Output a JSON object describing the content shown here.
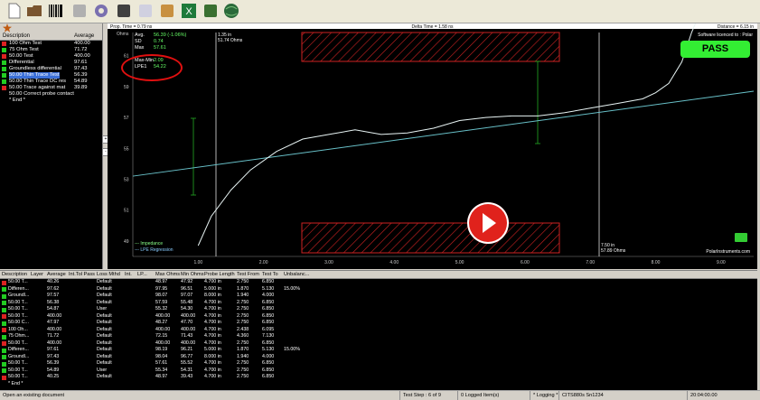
{
  "toolbar": {
    "buttons": [
      "new-document-icon",
      "open-folder-icon",
      "barcode-icon",
      "save-disk-icon",
      "settings-gear-icon",
      "printer-icon",
      "report-icon",
      "probe-icon",
      "excel-export-icon",
      "calibrate-icon",
      "globe-icon"
    ]
  },
  "left_panel": {
    "columns": [
      "Description",
      "Average"
    ],
    "rows": [
      {
        "desc": "100 Ohm Test",
        "avg": "400.00",
        "status": "fail"
      },
      {
        "desc": "75 Ohm Test",
        "avg": "71.72",
        "status": "pass"
      },
      {
        "desc": "50.00 Test",
        "avg": "400.00",
        "status": "fail"
      },
      {
        "desc": "Differential",
        "avg": "97.61",
        "status": "pass"
      },
      {
        "desc": "Groundless differential",
        "avg": "97.43",
        "status": "pass"
      },
      {
        "desc": "50.00 Thin Trace Test",
        "avg": "56.39",
        "status": "pass",
        "selected": true
      },
      {
        "desc": "50.00 Thin Trace DC res",
        "avg": "54.89",
        "status": "pass"
      },
      {
        "desc": "50.00 Trace against mat",
        "avg": "39.89",
        "status": "fail"
      },
      {
        "desc": "50.00 Correct probe contact",
        "avg": "",
        "status": "none"
      },
      {
        "desc": "* End *",
        "avg": "",
        "status": "none"
      }
    ]
  },
  "graph": {
    "prop_time": "Prop. Time = 0.79 ns",
    "delta_time": "Delta Time = 1.58 ns",
    "distance": "Distance = 6.15 in",
    "yunit": "Ohms",
    "stats": [
      {
        "k": "Avg.",
        "v": "56.39 (-1.06%)"
      },
      {
        "k": "SD",
        "v": "0.74"
      },
      {
        "k": "Max",
        "v": "57.61"
      },
      {
        "k": "Max-Min",
        "v": "2.09"
      },
      {
        "k": "LPE1",
        "v": "54.22"
      }
    ],
    "cursor1": {
      "in": "1.35 in",
      "ohms": "51.74 Ohms"
    },
    "cursor2": {
      "in": "7.50 in",
      "ohms": "57.89 Ohms"
    },
    "licence": "Software licenced to : Polar",
    "pass_label": "PASS",
    "legend": [
      "--- Impedance",
      "--- LPE Regression"
    ],
    "brand": "PolarInstruments.com",
    "y_ticks": [
      "61",
      "59",
      "57",
      "55",
      "53",
      "51",
      "49"
    ],
    "x_ticks": [
      "1.00",
      "2.00",
      "3.00",
      "4.00",
      "5.00",
      "6.00",
      "7.00",
      "8.00",
      "9.00"
    ],
    "chart_data": {
      "type": "line",
      "x": [
        1.0,
        1.2,
        1.5,
        1.8,
        2.2,
        2.6,
        3.0,
        3.4,
        3.8,
        4.2,
        4.6,
        5.0,
        5.4,
        5.8,
        6.2,
        6.6,
        7.0,
        7.4,
        7.8,
        8.0,
        8.2,
        8.4,
        8.55,
        8.7
      ],
      "series": [
        {
          "name": "Impedance",
          "values": [
            48.7,
            50.6,
            52.3,
            53.6,
            54.8,
            55.6,
            55.9,
            56.2,
            55.9,
            56.0,
            56.3,
            56.8,
            57.0,
            57.1,
            57.1,
            57.3,
            57.6,
            57.9,
            58.2,
            58.6,
            59.2,
            60.6,
            62.5,
            64.0
          ]
        },
        {
          "name": "LPE Regression",
          "x": [
            0,
            9.5
          ],
          "values": [
            53.2,
            58.7
          ]
        }
      ],
      "xlim": [
        0,
        9.5
      ],
      "ylim": [
        48,
        62.5
      ]
    }
  },
  "table": {
    "columns": [
      "Description",
      "Layer",
      "Average",
      "Int.Tol Pass",
      "Loss Mthd",
      "Int.",
      "LP...",
      "Max Ohms",
      "Min Ohms",
      "Probe Length",
      "Test From",
      "Test To",
      "Unbalanc..."
    ],
    "rows": [
      {
        "st": "fail",
        "c": [
          "50.00 T...",
          "",
          "40.26",
          "",
          "Default",
          "",
          "",
          "48.97",
          "47.92",
          "4.700 in",
          "2.750",
          "6.850",
          ""
        ]
      },
      {
        "st": "pass",
        "c": [
          "Differen...",
          "",
          "97.62",
          "",
          "Default",
          "",
          "",
          "97.95",
          "96.51",
          "5.000 in",
          "1.870",
          "5.130",
          "15.00%"
        ]
      },
      {
        "st": "pass",
        "c": [
          "Groundl...",
          "",
          "97.57",
          "",
          "Default",
          "",
          "",
          "98.07",
          "97.07",
          "8.000 in",
          "1.940",
          "4.000",
          ""
        ]
      },
      {
        "st": "pass",
        "c": [
          "50.00 T...",
          "",
          "56.38",
          "",
          "Default",
          "",
          "",
          "57.59",
          "55.48",
          "4.700 in",
          "2.750",
          "6.850",
          ""
        ]
      },
      {
        "st": "pass",
        "c": [
          "50.00 T...",
          "",
          "54.87",
          "",
          "User",
          "",
          "",
          "55.32",
          "54.30",
          "4.700 in",
          "2.750",
          "6.850",
          ""
        ]
      },
      {
        "st": "fail",
        "c": [
          "50.00 T...",
          "",
          "400.00",
          "",
          "Default",
          "",
          "",
          "400.00",
          "400.00",
          "4.700 in",
          "2.750",
          "6.850",
          ""
        ]
      },
      {
        "st": "pass",
        "c": [
          "50.00 C...",
          "",
          "47.97",
          "",
          "Default",
          "",
          "",
          "48.27",
          "47.70",
          "4.700 in",
          "2.750",
          "6.850",
          ""
        ]
      },
      {
        "st": "fail",
        "c": [
          "100 Oh...",
          "",
          "400.00",
          "",
          "Default",
          "",
          "",
          "400.00",
          "400.00",
          "4.700 in",
          "2.438",
          "6.095",
          ""
        ]
      },
      {
        "st": "pass",
        "c": [
          "75 Ohm...",
          "",
          "71.72",
          "",
          "Default",
          "",
          "",
          "72.15",
          "71.43",
          "4.700 in",
          "4.360",
          "7.130",
          ""
        ]
      },
      {
        "st": "fail",
        "c": [
          "50.00 T...",
          "",
          "400.00",
          "",
          "Default",
          "",
          "",
          "400.00",
          "400.00",
          "4.700 in",
          "2.750",
          "6.850",
          ""
        ]
      },
      {
        "st": "pass",
        "c": [
          "Differen...",
          "",
          "97.61",
          "",
          "Default",
          "",
          "",
          "98.19",
          "96.21",
          "5.000 in",
          "1.870",
          "5.130",
          "15.00%"
        ]
      },
      {
        "st": "pass",
        "c": [
          "Groundl...",
          "",
          "97.43",
          "",
          "Default",
          "",
          "",
          "98.04",
          "96.77",
          "8.000 in",
          "1.940",
          "4.000",
          ""
        ]
      },
      {
        "st": "pass",
        "c": [
          "50.00 T...",
          "",
          "56.39",
          "",
          "Default",
          "",
          "",
          "57.61",
          "55.52",
          "4.700 in",
          "2.750",
          "6.850",
          ""
        ]
      },
      {
        "st": "pass",
        "c": [
          "50.00 T...",
          "",
          "54.89",
          "",
          "User",
          "",
          "",
          "55.34",
          "54.31",
          "4.700 in",
          "2.750",
          "6.850",
          ""
        ]
      },
      {
        "st": "fail",
        "c": [
          "50.00 T...",
          "",
          "40.25",
          "",
          "Default",
          "",
          "",
          "48.97",
          "39.43",
          "4.700 in",
          "2.750",
          "6.850",
          ""
        ]
      },
      {
        "st": "none",
        "c": [
          "* End *",
          "",
          "",
          "",
          "",
          "",
          "",
          "",
          "",
          "",
          "",
          "",
          ""
        ]
      }
    ]
  },
  "status": {
    "msg": "Open an existing document",
    "step": "Test Step : 6 of 9",
    "logged": "0 Logged Item(s)",
    "logging": "* Logging *",
    "serial": "CITS880s Sn1234",
    "time": "20:04:00.00"
  },
  "colors": {
    "pass": "#22cc22",
    "fail": "#dd2222",
    "trace": "#e8f4f4",
    "regression": "#68c0c8",
    "limits": "#cc2222",
    "cursor": "#ffffff",
    "spec_bar": "#22aa22"
  }
}
